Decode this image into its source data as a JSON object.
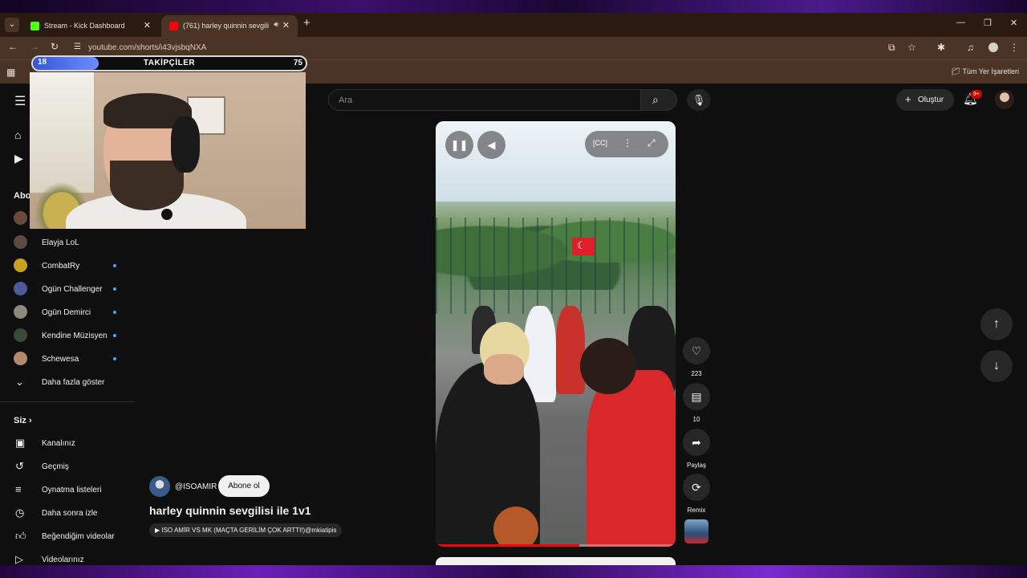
{
  "browser": {
    "tabs": [
      {
        "title": "Stream - Kick Dashboard",
        "favicon_color": "#53fc18",
        "active": false
      },
      {
        "title": "(761) harley quinnin sevgili",
        "favicon_color": "#ff0000",
        "active": true
      }
    ],
    "url": "youtube.com/shorts/i43vjsbqNXA",
    "bookmarks_all": "Tüm Yer İşaretleri"
  },
  "overlay": {
    "follower_goal": {
      "current": "18",
      "label": "TAKİPÇİLER",
      "goal": "75",
      "progress": 0.24
    }
  },
  "youtube": {
    "search_placeholder": "Ara",
    "create_label": "Oluştur",
    "notification_count": "9+",
    "subscriptions_heading": "Abo",
    "subscriptions": [
      {
        "name": "Elayja LoL",
        "color": "#5a4a40",
        "new": false
      },
      {
        "name": "CombatRy",
        "color": "#c8a020",
        "new": true
      },
      {
        "name": "Ogün Challenger",
        "color": "#4a5a9a",
        "new": true
      },
      {
        "name": "Ogün Demirci",
        "color": "#8a8a7a",
        "new": true
      },
      {
        "name": "Kendine Müzisyen",
        "color": "#3a4a3a",
        "new": true
      },
      {
        "name": "Schewesa",
        "color": "#b08a6a",
        "new": true
      }
    ],
    "show_more": "Daha fazla göster",
    "you_section": "Siz",
    "you_items": [
      {
        "label": "Kanalınız",
        "icon": "channel-icon"
      },
      {
        "label": "Geçmiş",
        "icon": "history-icon"
      },
      {
        "label": "Oynatma listeleri",
        "icon": "playlists-icon"
      },
      {
        "label": "Daha sonra izle",
        "icon": "watch-later-icon"
      },
      {
        "label": "Beğendiğim videolar",
        "icon": "liked-icon"
      },
      {
        "label": "Videolarınız",
        "icon": "your-videos-icon"
      }
    ],
    "short": {
      "channel": "@ISOAMIR",
      "subscribe_label": "Abone ol",
      "title": "harley quinnin sevgilisi ile 1v1",
      "related": "▶ ISO AMİR VS MK (MAÇTA GERİLİM ÇOK ARTTI!)@mkiatipis",
      "likes": "223",
      "comments": "10",
      "share_label": "Paylaş",
      "remix_label": "Remix",
      "progress": 0.6
    }
  }
}
